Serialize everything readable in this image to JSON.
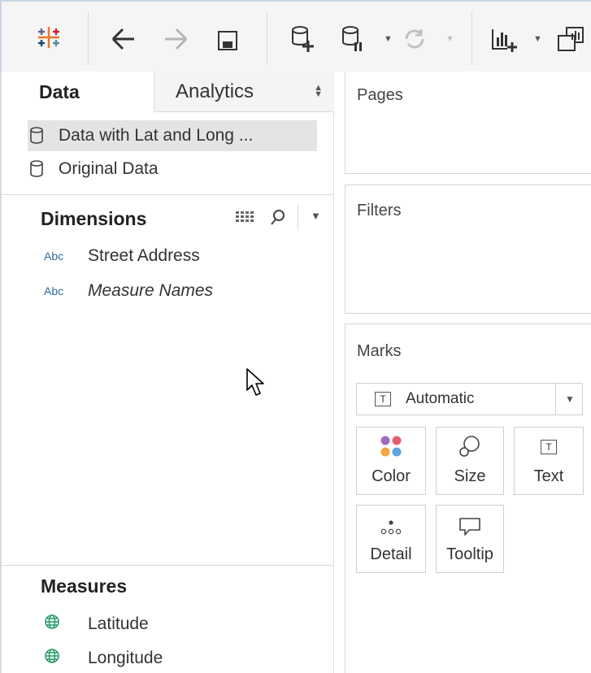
{
  "left_panel": {
    "tabs": [
      {
        "label": "Data"
      },
      {
        "label": "Analytics"
      }
    ],
    "data_sources": [
      {
        "label": "Data with Lat and Long ..."
      },
      {
        "label": "Original Data"
      }
    ],
    "dimensions": {
      "title": "Dimensions",
      "fields": [
        {
          "type_badge": "Abc",
          "label": "Street Address"
        },
        {
          "type_badge": "Abc",
          "label": "Measure Names"
        }
      ]
    },
    "measures": {
      "title": "Measures",
      "fields": [
        {
          "label": "Latitude"
        },
        {
          "label": "Longitude"
        }
      ]
    }
  },
  "shelves": {
    "pages": {
      "title": "Pages"
    },
    "filters": {
      "title": "Filters"
    },
    "marks": {
      "title": "Marks",
      "mark_type": "Automatic",
      "buttons": [
        {
          "label": "Color"
        },
        {
          "label": "Size"
        },
        {
          "label": "Text"
        },
        {
          "label": "Detail"
        },
        {
          "label": "Tooltip"
        }
      ]
    }
  },
  "colors": {
    "accent_blue": "#2e6ca3",
    "measure_green": "#2e9e6e"
  }
}
